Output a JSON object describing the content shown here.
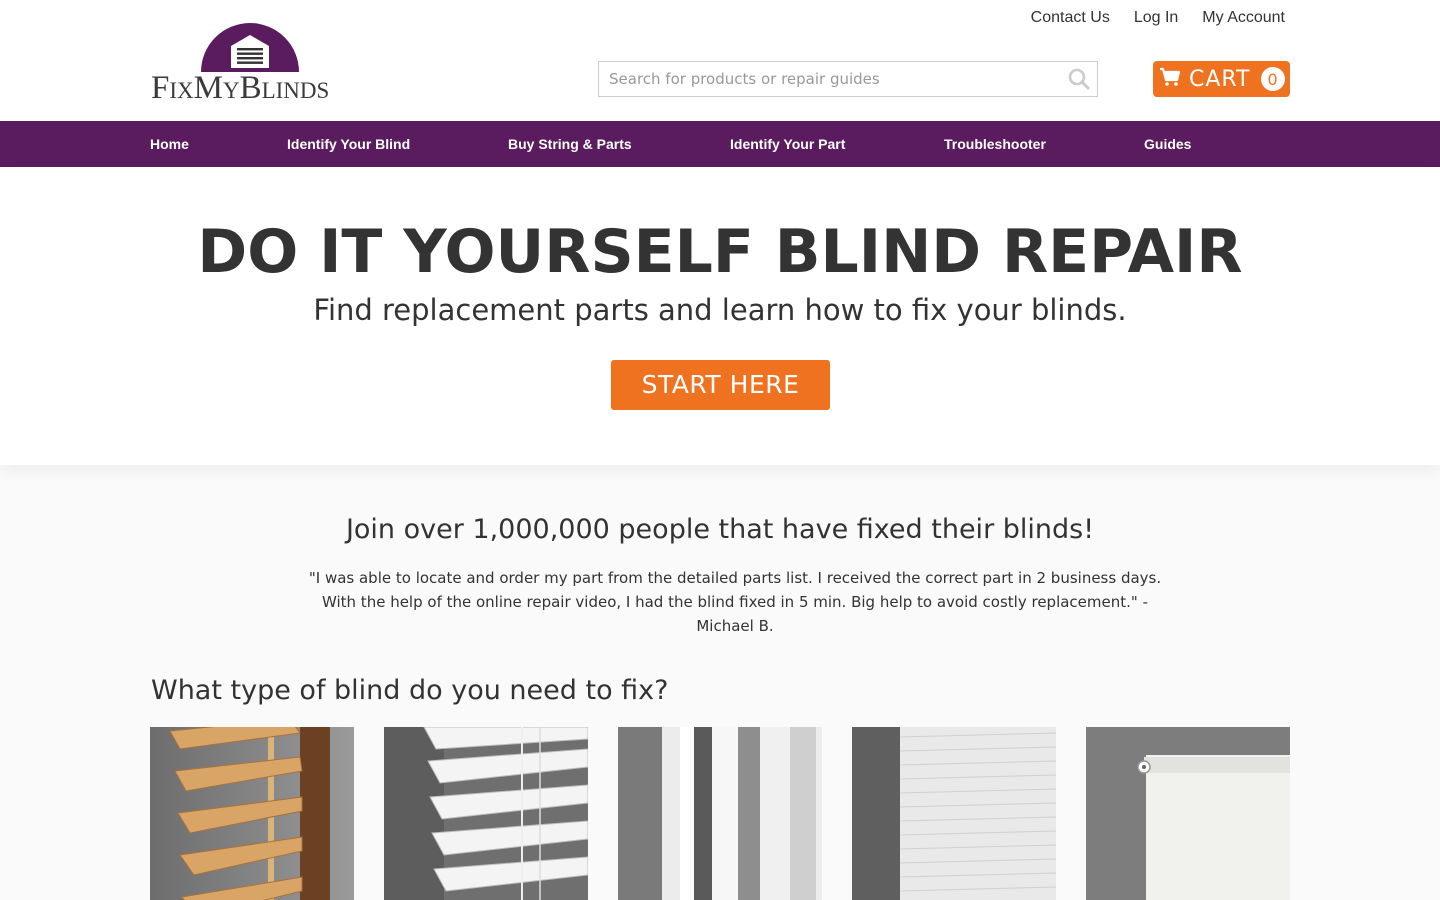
{
  "header": {
    "logo_text": "FixMyBlinds",
    "links": [
      "Contact Us",
      "Log In",
      "My Account"
    ],
    "search_placeholder": "Search for products or repair guides",
    "cart_label": "CART",
    "cart_count": "0",
    "cart_icon": "shopping-cart-icon",
    "search_icon": "magnifier-icon"
  },
  "nav": {
    "items": [
      "Home",
      "Identify Your Blind",
      "Buy String & Parts",
      "Identify Your Part",
      "Troubleshooter",
      "Guides"
    ]
  },
  "hero": {
    "title": "DO IT YOURSELF BLIND REPAIR",
    "subtitle": "Find replacement parts and learn how to fix your blinds.",
    "cta": "START HERE"
  },
  "testimonial": {
    "headline": "Join over 1,000,000 people that have fixed their blinds!",
    "quote": "\"I was able to locate and order my part from the detailed parts list. I received the correct part in 2 business days. With the help of the online repair video, I had the blind fixed in 5 min. Big help to avoid costly replacement.\"   - Michael B."
  },
  "blind_types": {
    "heading": "What type of blind do you need to fix?"
  },
  "colors": {
    "purple": "#5b1b5f",
    "orange": "#ef7220",
    "text": "#333333"
  }
}
